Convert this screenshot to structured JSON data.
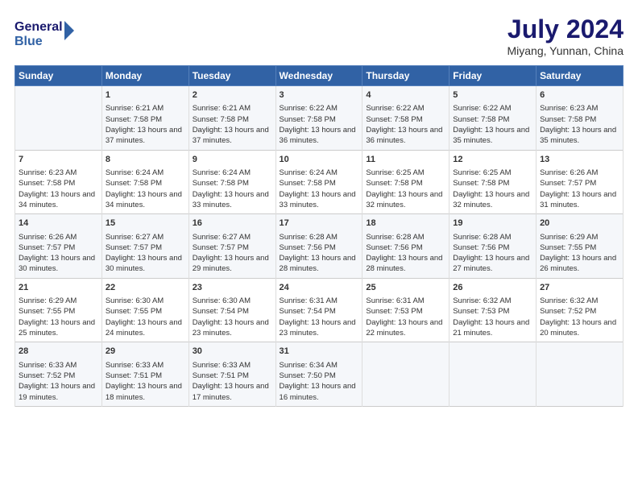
{
  "header": {
    "logo_line1": "General",
    "logo_line2": "Blue",
    "title": "July 2024",
    "subtitle": "Miyang, Yunnan, China"
  },
  "calendar": {
    "days_of_week": [
      "Sunday",
      "Monday",
      "Tuesday",
      "Wednesday",
      "Thursday",
      "Friday",
      "Saturday"
    ],
    "weeks": [
      [
        {
          "day": "",
          "content": ""
        },
        {
          "day": "1",
          "content": "Sunrise: 6:21 AM\nSunset: 7:58 PM\nDaylight: 13 hours and 37 minutes."
        },
        {
          "day": "2",
          "content": "Sunrise: 6:21 AM\nSunset: 7:58 PM\nDaylight: 13 hours and 37 minutes."
        },
        {
          "day": "3",
          "content": "Sunrise: 6:22 AM\nSunset: 7:58 PM\nDaylight: 13 hours and 36 minutes."
        },
        {
          "day": "4",
          "content": "Sunrise: 6:22 AM\nSunset: 7:58 PM\nDaylight: 13 hours and 36 minutes."
        },
        {
          "day": "5",
          "content": "Sunrise: 6:22 AM\nSunset: 7:58 PM\nDaylight: 13 hours and 35 minutes."
        },
        {
          "day": "6",
          "content": "Sunrise: 6:23 AM\nSunset: 7:58 PM\nDaylight: 13 hours and 35 minutes."
        }
      ],
      [
        {
          "day": "7",
          "content": "Sunrise: 6:23 AM\nSunset: 7:58 PM\nDaylight: 13 hours and 34 minutes."
        },
        {
          "day": "8",
          "content": "Sunrise: 6:24 AM\nSunset: 7:58 PM\nDaylight: 13 hours and 34 minutes."
        },
        {
          "day": "9",
          "content": "Sunrise: 6:24 AM\nSunset: 7:58 PM\nDaylight: 13 hours and 33 minutes."
        },
        {
          "day": "10",
          "content": "Sunrise: 6:24 AM\nSunset: 7:58 PM\nDaylight: 13 hours and 33 minutes."
        },
        {
          "day": "11",
          "content": "Sunrise: 6:25 AM\nSunset: 7:58 PM\nDaylight: 13 hours and 32 minutes."
        },
        {
          "day": "12",
          "content": "Sunrise: 6:25 AM\nSunset: 7:58 PM\nDaylight: 13 hours and 32 minutes."
        },
        {
          "day": "13",
          "content": "Sunrise: 6:26 AM\nSunset: 7:57 PM\nDaylight: 13 hours and 31 minutes."
        }
      ],
      [
        {
          "day": "14",
          "content": "Sunrise: 6:26 AM\nSunset: 7:57 PM\nDaylight: 13 hours and 30 minutes."
        },
        {
          "day": "15",
          "content": "Sunrise: 6:27 AM\nSunset: 7:57 PM\nDaylight: 13 hours and 30 minutes."
        },
        {
          "day": "16",
          "content": "Sunrise: 6:27 AM\nSunset: 7:57 PM\nDaylight: 13 hours and 29 minutes."
        },
        {
          "day": "17",
          "content": "Sunrise: 6:28 AM\nSunset: 7:56 PM\nDaylight: 13 hours and 28 minutes."
        },
        {
          "day": "18",
          "content": "Sunrise: 6:28 AM\nSunset: 7:56 PM\nDaylight: 13 hours and 28 minutes."
        },
        {
          "day": "19",
          "content": "Sunrise: 6:28 AM\nSunset: 7:56 PM\nDaylight: 13 hours and 27 minutes."
        },
        {
          "day": "20",
          "content": "Sunrise: 6:29 AM\nSunset: 7:55 PM\nDaylight: 13 hours and 26 minutes."
        }
      ],
      [
        {
          "day": "21",
          "content": "Sunrise: 6:29 AM\nSunset: 7:55 PM\nDaylight: 13 hours and 25 minutes."
        },
        {
          "day": "22",
          "content": "Sunrise: 6:30 AM\nSunset: 7:55 PM\nDaylight: 13 hours and 24 minutes."
        },
        {
          "day": "23",
          "content": "Sunrise: 6:30 AM\nSunset: 7:54 PM\nDaylight: 13 hours and 23 minutes."
        },
        {
          "day": "24",
          "content": "Sunrise: 6:31 AM\nSunset: 7:54 PM\nDaylight: 13 hours and 23 minutes."
        },
        {
          "day": "25",
          "content": "Sunrise: 6:31 AM\nSunset: 7:53 PM\nDaylight: 13 hours and 22 minutes."
        },
        {
          "day": "26",
          "content": "Sunrise: 6:32 AM\nSunset: 7:53 PM\nDaylight: 13 hours and 21 minutes."
        },
        {
          "day": "27",
          "content": "Sunrise: 6:32 AM\nSunset: 7:52 PM\nDaylight: 13 hours and 20 minutes."
        }
      ],
      [
        {
          "day": "28",
          "content": "Sunrise: 6:33 AM\nSunset: 7:52 PM\nDaylight: 13 hours and 19 minutes."
        },
        {
          "day": "29",
          "content": "Sunrise: 6:33 AM\nSunset: 7:51 PM\nDaylight: 13 hours and 18 minutes."
        },
        {
          "day": "30",
          "content": "Sunrise: 6:33 AM\nSunset: 7:51 PM\nDaylight: 13 hours and 17 minutes."
        },
        {
          "day": "31",
          "content": "Sunrise: 6:34 AM\nSunset: 7:50 PM\nDaylight: 13 hours and 16 minutes."
        },
        {
          "day": "",
          "content": ""
        },
        {
          "day": "",
          "content": ""
        },
        {
          "day": "",
          "content": ""
        }
      ]
    ]
  }
}
